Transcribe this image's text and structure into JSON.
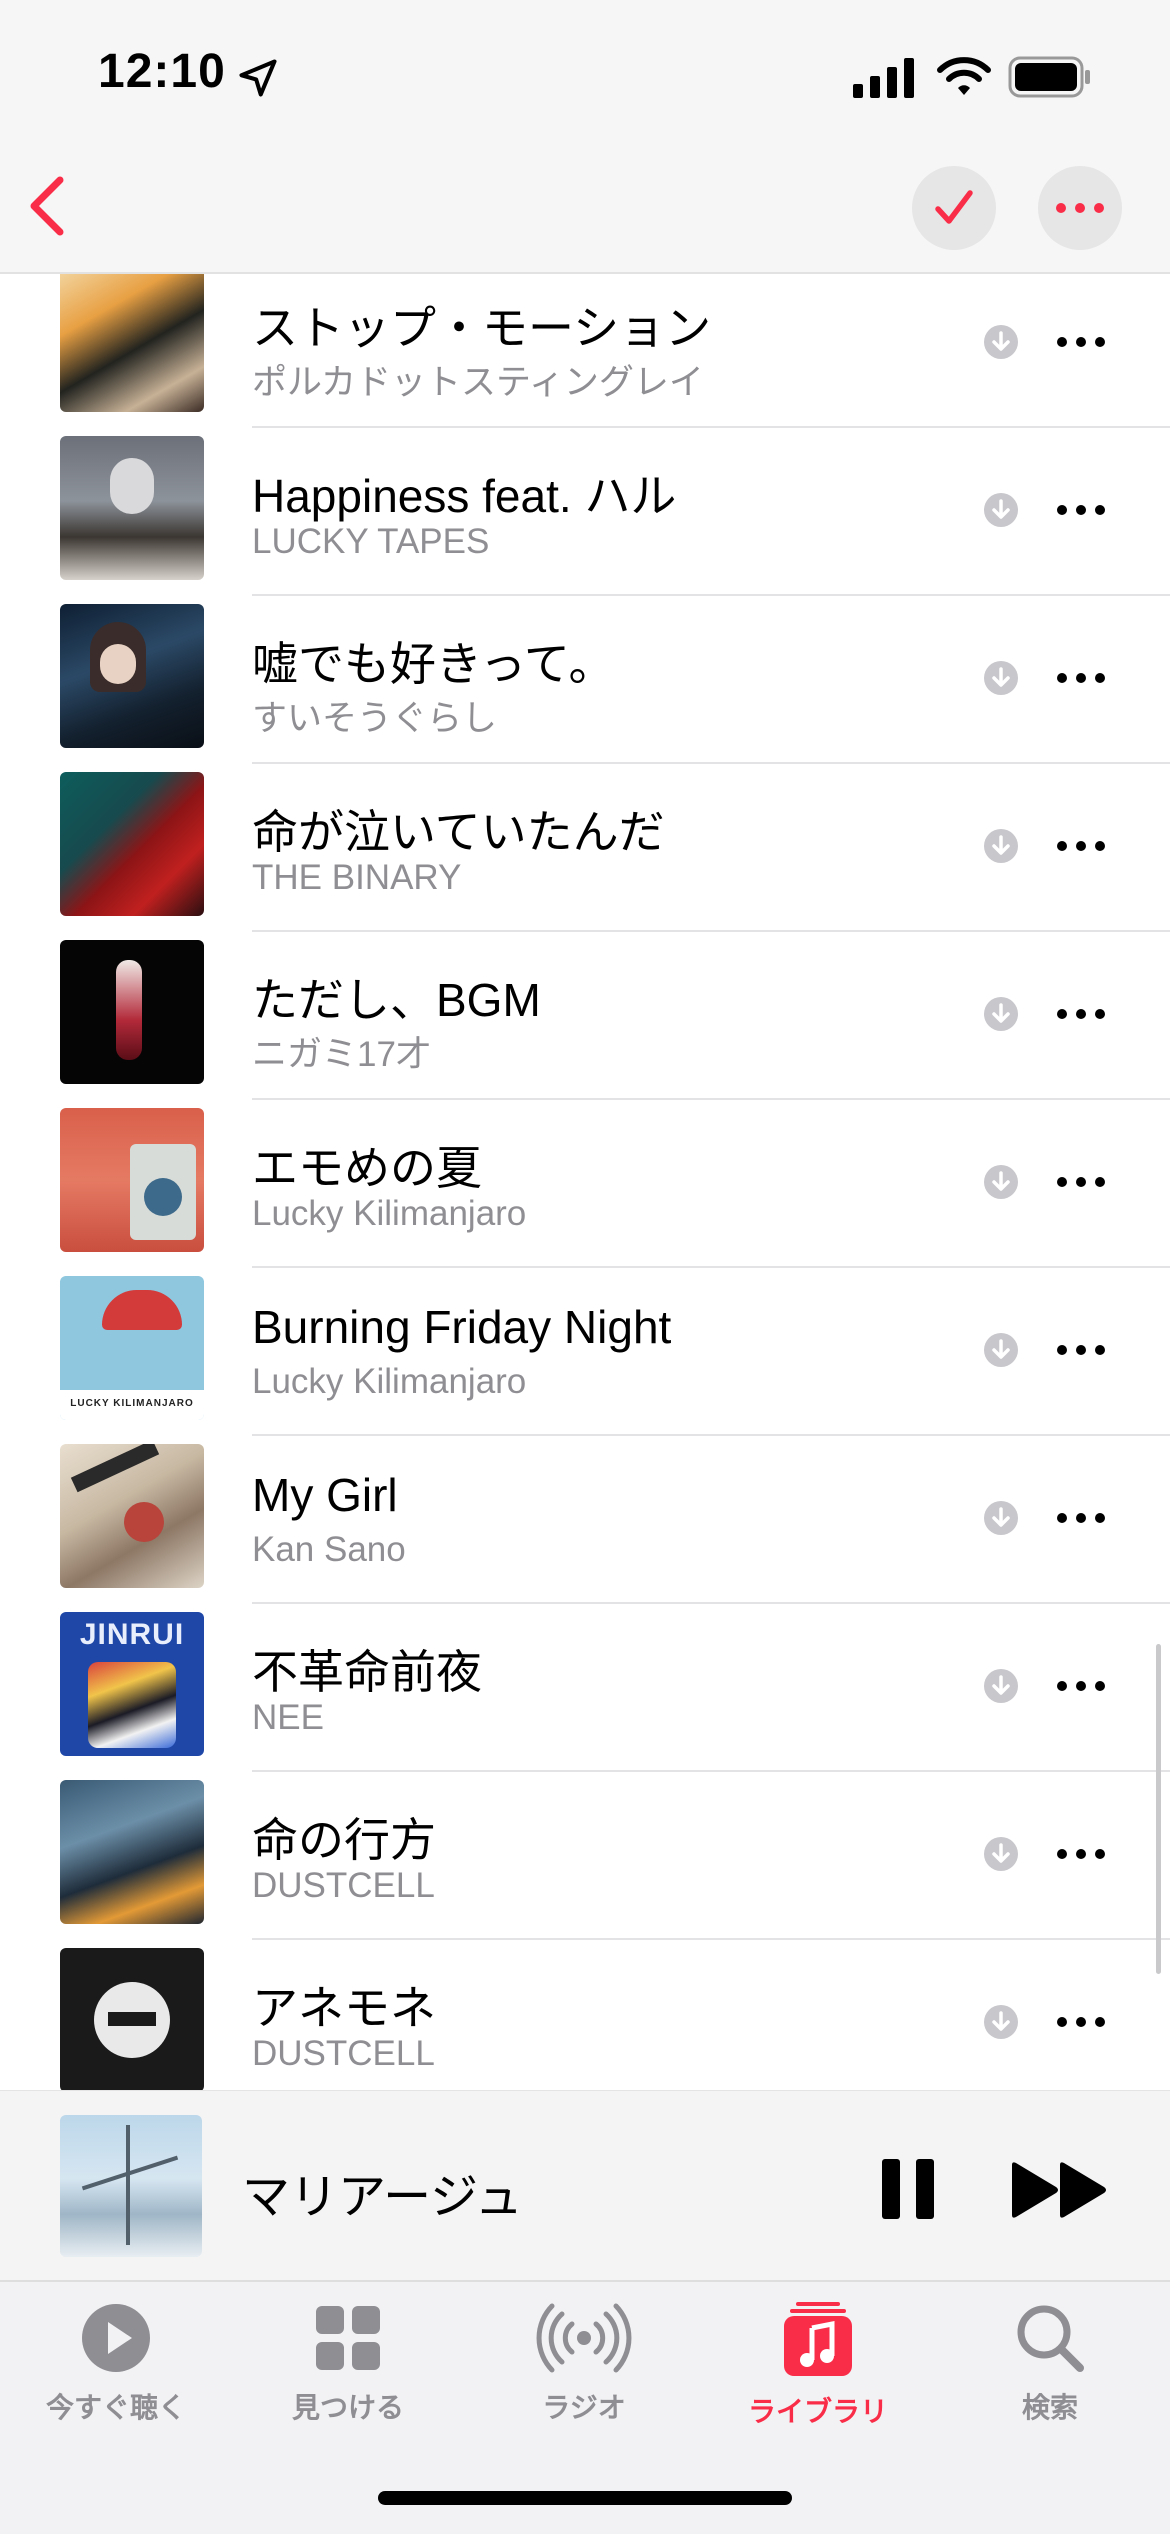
{
  "status_bar": {
    "time": "12:10"
  },
  "header": {
    "back_icon": "chevron-left-icon",
    "check_icon": "checkmark-icon",
    "more_icon": "ellipsis-icon",
    "accent_color": "#fa2d48"
  },
  "songs": [
    {
      "title": "ストップ・モーション",
      "artist": "ポルカドットスティングレイ"
    },
    {
      "title": "Happiness feat. ハル",
      "artist": "LUCKY TAPES"
    },
    {
      "title": "嘘でも好きって。",
      "artist": "すいそうぐらし"
    },
    {
      "title": "命が泣いていたんだ",
      "artist": "THE BINARY"
    },
    {
      "title": "ただし、BGM",
      "artist": "ニガミ17才"
    },
    {
      "title": "エモめの夏",
      "artist": "Lucky Kilimanjaro"
    },
    {
      "title": "Burning Friday Night",
      "artist": "Lucky Kilimanjaro"
    },
    {
      "title": "My Girl",
      "artist": "Kan Sano"
    },
    {
      "title": "不革命前夜",
      "artist": "NEE"
    },
    {
      "title": "命の行方",
      "artist": "DUSTCELL"
    },
    {
      "title": "アネモネ",
      "artist": "DUSTCELL"
    }
  ],
  "album_art_text": {
    "binary_cover": "LUCKY KILIMANJARO",
    "jinrui_cover": "JINRUI"
  },
  "now_playing": {
    "title": "マリアージュ"
  },
  "tabs": [
    {
      "label": "今すぐ聴く",
      "icon": "play-circle-icon"
    },
    {
      "label": "見つける",
      "icon": "grid-icon"
    },
    {
      "label": "ラジオ",
      "icon": "radio-waves-icon"
    },
    {
      "label": "ライブラリ",
      "icon": "music-library-icon",
      "active": true
    },
    {
      "label": "検索",
      "icon": "search-icon"
    }
  ]
}
